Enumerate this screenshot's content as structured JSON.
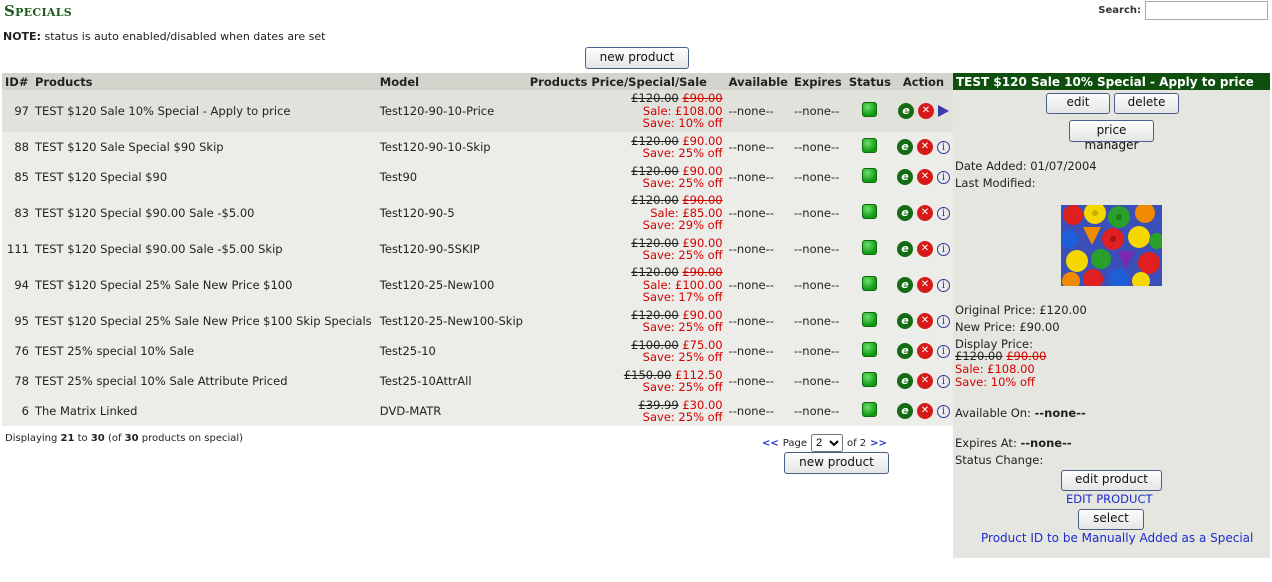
{
  "page": {
    "title": "Specials"
  },
  "search": {
    "label": "Search:",
    "value": ""
  },
  "note": {
    "bold": "NOTE:",
    "text": " status is auto enabled/disabled when dates are set"
  },
  "buttons": {
    "new_product_top": "new product",
    "new_product_bottom": "new product"
  },
  "table": {
    "headers": [
      "ID#",
      "Products",
      "Model",
      "Products Price/Special/Sale",
      "Available",
      "Expires",
      "Status",
      "Action"
    ],
    "rows": [
      {
        "id": "97",
        "product": "TEST $120 Sale 10% Special - Apply to price",
        "model": "Test120-90-10-Price",
        "orig": "£120.00",
        "special": "£90.00",
        "special_strike": true,
        "sale": "Sale: £108.00",
        "save": "Save: 10% off",
        "available": "--none--",
        "expires": "--none--",
        "selected": true
      },
      {
        "id": "88",
        "product": "TEST $120 Sale Special $90 Skip",
        "model": "Test120-90-10-Skip",
        "orig": "£120.00",
        "special": "£90.00",
        "special_strike": false,
        "sale": "",
        "save": "Save: 25% off",
        "available": "--none--",
        "expires": "--none--"
      },
      {
        "id": "85",
        "product": "TEST $120 Special $90",
        "model": "Test90",
        "orig": "£120.00",
        "special": "£90.00",
        "special_strike": false,
        "sale": "",
        "save": "Save: 25% off",
        "available": "--none--",
        "expires": "--none--"
      },
      {
        "id": "83",
        "product": "TEST $120 Special $90.00 Sale -$5.00",
        "model": "Test120-90-5",
        "orig": "£120.00",
        "special": "£90.00",
        "special_strike": true,
        "sale": "Sale: £85.00",
        "save": "Save: 29% off",
        "available": "--none--",
        "expires": "--none--"
      },
      {
        "id": "111",
        "product": "TEST $120 Special $90.00 Sale -$5.00 Skip",
        "model": "Test120-90-5SKIP",
        "orig": "£120.00",
        "special": "£90.00",
        "special_strike": false,
        "sale": "",
        "save": "Save: 25% off",
        "available": "--none--",
        "expires": "--none--"
      },
      {
        "id": "94",
        "product": "TEST $120 Special 25% Sale New Price $100",
        "model": "Test120-25-New100",
        "orig": "£120.00",
        "special": "£90.00",
        "special_strike": true,
        "sale": "Sale: £100.00",
        "save": "Save: 17% off",
        "available": "--none--",
        "expires": "--none--"
      },
      {
        "id": "95",
        "product": "TEST $120 Special 25% Sale New Price $100 Skip Specials",
        "model": "Test120-25-New100-Skip",
        "orig": "£120.00",
        "special": "£90.00",
        "special_strike": false,
        "sale": "",
        "save": "Save: 25% off",
        "available": "--none--",
        "expires": "--none--"
      },
      {
        "id": "76",
        "product": "TEST 25% special 10% Sale",
        "model": "Test25-10",
        "orig": "£100.00",
        "special": "£75.00",
        "special_strike": false,
        "sale": "",
        "save": "Save: 25% off",
        "available": "--none--",
        "expires": "--none--"
      },
      {
        "id": "78",
        "product": "TEST 25% special 10% Sale Attribute Priced",
        "model": "Test25-10AttrAll",
        "orig": "£150.00",
        "special": "£112.50",
        "special_strike": false,
        "sale": "",
        "save": "Save: 25% off",
        "available": "--none--",
        "expires": "--none--"
      },
      {
        "id": "6",
        "product": "The Matrix Linked",
        "model": "DVD-MATR",
        "orig": "£39.99",
        "special": "£30.00",
        "special_strike": false,
        "sale": "",
        "save": "Save: 25% off",
        "available": "--none--",
        "expires": "--none--"
      }
    ]
  },
  "footer": {
    "displaying_prefix": "Displaying ",
    "from": "21",
    "to_word": " to ",
    "to": "30",
    "of_prefix": " (of ",
    "total": "30",
    "suffix": " products on special)",
    "pager_prev": "<<",
    "page_label": "Page",
    "page_value": "2",
    "of_label": "of 2",
    "pager_next": ">>"
  },
  "sidebar": {
    "heading": "TEST $120 Sale 10% Special - Apply to price",
    "edit": "edit",
    "delete": "delete",
    "price_manager": "price manager",
    "date_added": "Date Added: 01/07/2004",
    "last_modified": "Last Modified:",
    "original_price": "Original Price: £120.00",
    "new_price": "New Price: £90.00",
    "display_price_label": "Display Price:",
    "display_orig": "£120.00",
    "display_special": "£90.00",
    "display_sale": "Sale: £108.00",
    "display_save": "Save: 10% off",
    "available_on_label": "Available On: ",
    "available_on_value": "--none--",
    "expires_at_label": "Expires At: ",
    "expires_at_value": "--none--",
    "status_change": "Status Change:",
    "edit_product": "edit product",
    "edit_product_link": "EDIT PRODUCT",
    "select": "select",
    "manual_link": "Product ID to be Manually Added as a Special"
  },
  "icons": {
    "edit": "edit-icon",
    "delete": "delete-icon",
    "info": "info-icon",
    "selected": "selected-arrow-icon",
    "status": "status-on-icon"
  }
}
